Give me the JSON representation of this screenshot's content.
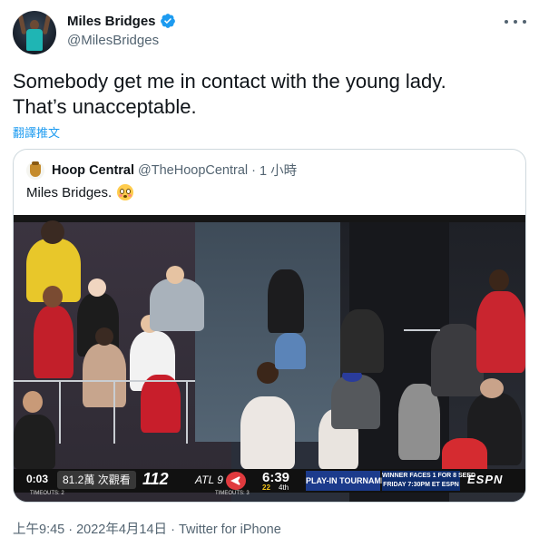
{
  "tweet": {
    "author_name": "Miles Bridges",
    "author_handle": "@MilesBridges",
    "text_line1": "Somebody get me in contact with the young lady.",
    "text_line2": "That’s unacceptable.",
    "translate_label": "翻譯推文",
    "timestamp": "上午9:45 · 2022年4月14日 · Twitter for iPhone"
  },
  "quote": {
    "author_name": "Hoop Central",
    "author_handle": "@TheHoopCentral",
    "separator": "·",
    "time": "1 小時",
    "text": "Miles Bridges."
  },
  "scoreboard": {
    "clock_played": "0:03",
    "views": "81.2萬 次觀看",
    "home_score": "112",
    "away_label": "ATL 9",
    "game_clock": "6:39",
    "shot_clock": "22",
    "quarter": "4th",
    "playin_label": "PLAY-IN TOURNAMENT",
    "winner_line1": "WINNER FACES 1 FOR 8 SEED",
    "winner_line2": "FRIDAY 7:30PM ET ESPN",
    "network": "ESPN",
    "timeouts_left": "TIMEOUTS: 2",
    "timeouts_right": "TIMEOUTS: 3"
  },
  "icons": {
    "verified": "verified-badge-icon",
    "more": "more-options-icon",
    "emoji": "flushed-face-icon"
  },
  "colors": {
    "link": "#1d9bf0",
    "secondary_text": "#536471",
    "border": "#cfd9de"
  }
}
